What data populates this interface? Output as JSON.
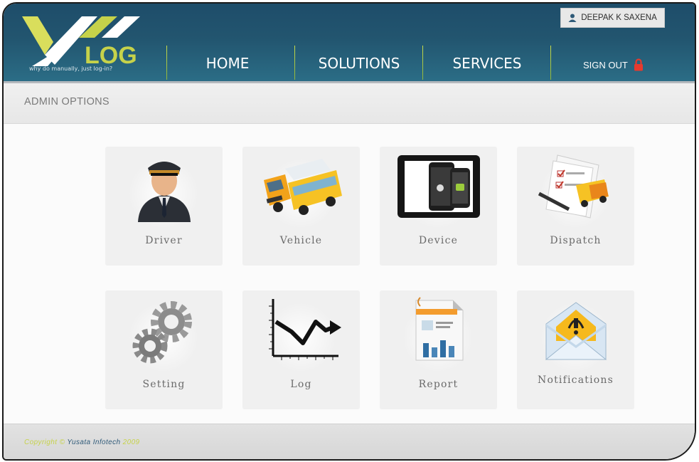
{
  "header": {
    "logo_text": "LOG",
    "tagline": "why do manually, just log-in?",
    "user_name": "DEEPAK K SAXENA",
    "nav": [
      "HOME",
      "SOLUTIONS",
      "SERVICES"
    ],
    "sign_out": "SIGN OUT"
  },
  "page": {
    "section_title": "ADMIN OPTIONS"
  },
  "tiles": [
    {
      "label": "Driver",
      "icon": "driver-icon"
    },
    {
      "label": "Vehicle",
      "icon": "vehicle-icon"
    },
    {
      "label": "Device",
      "icon": "device-icon"
    },
    {
      "label": "Dispatch",
      "icon": "dispatch-icon"
    },
    {
      "label": "Setting",
      "icon": "gears-icon"
    },
    {
      "label": "Log",
      "icon": "chart-icon"
    },
    {
      "label": "Report",
      "icon": "report-icon"
    },
    {
      "label": "Notifications",
      "icon": "envelope-icon"
    }
  ],
  "footer": {
    "prefix": "Copyright ©",
    "company": "Yusata Infotech",
    "year": "2009"
  },
  "colors": {
    "header": "#22556f",
    "accent_lime": "#c6d24a",
    "lock": "#e63a2e"
  }
}
